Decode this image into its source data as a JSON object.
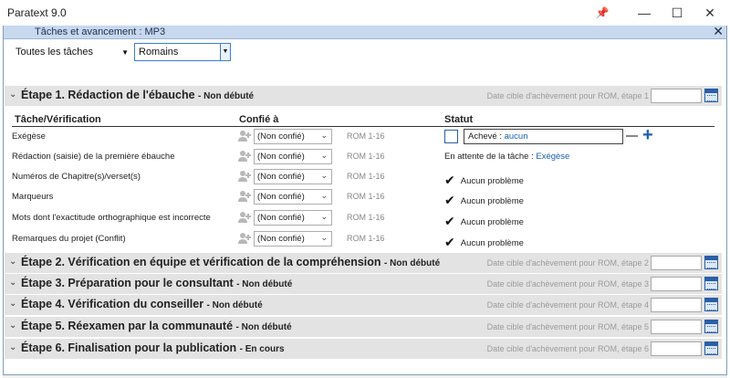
{
  "window": {
    "title": "Paratext 9.0",
    "pin": "📌",
    "min": "—",
    "max": "☐",
    "close": "✕"
  },
  "panel": {
    "title": "Tâches et avancement : MP3",
    "close": "✕"
  },
  "toolbar": {
    "tasks_filter": "Toutes les tâches",
    "book": "Romains"
  },
  "stage1": {
    "name": "Étape 1. Rédaction de l'ébauche",
    "status": "- Non débuté",
    "target": "Date cible d'achèvement pour ROM, étape 1",
    "headers": {
      "task": "Tâche/Vérification",
      "assigned": "Confié à",
      "status": "Statut"
    },
    "rows": [
      {
        "task": "Exégèse",
        "assigned": "(Non confié)",
        "ref": "ROM 1-16",
        "status_label": "Achevé : ",
        "status_link": "aucun"
      },
      {
        "task": "Rédaction (saisie) de la première ébauche",
        "assigned": "(Non confié)",
        "ref": "ROM 1-16",
        "status_label": "En attente de la tâche : ",
        "status_link": "Exégèse"
      },
      {
        "task": "Numéros de Chapitre(s)/verset(s)",
        "assigned": "(Non confié)",
        "ref": "ROM 1-16",
        "status_label": "Aucun problème"
      },
      {
        "task": "Marqueurs",
        "assigned": "(Non confié)",
        "ref": "ROM 1-16",
        "status_label": "Aucun problème"
      },
      {
        "task": "Mots dont l'exactitude orthographique est incorrecte",
        "assigned": "(Non confié)",
        "ref": "ROM 1-16",
        "status_label": "Aucun problème"
      },
      {
        "task": "Remarques du projet (Conflit)",
        "assigned": "(Non confié)",
        "ref": "ROM 1-16",
        "status_label": "Aucun problème"
      }
    ]
  },
  "stages": [
    {
      "name": "Étape 2. Vérification en équipe et vérification de la compréhension",
      "status": "- Non débuté",
      "target": "Date cible d'achèvement pour ROM, étape 2"
    },
    {
      "name": "Étape 3. Préparation pour le consultant",
      "status": "- Non débuté",
      "target": "Date cible d'achèvement pour ROM, étape 3"
    },
    {
      "name": "Étape 4. Vérification du conseiller",
      "status": "- Non débuté",
      "target": "Date cible d'achèvement pour ROM, étape 4"
    },
    {
      "name": "Étape 5. Réexamen par la communauté",
      "status": "- Non débuté",
      "target": "Date cible d'achèvement pour ROM, étape 5"
    },
    {
      "name": "Étape 6. Finalisation pour la publication",
      "status": "- En cours",
      "target": "Date cible d'achèvement pour ROM, étape 6"
    }
  ],
  "icons": {
    "check": "✔",
    "chevron_open": "⌄",
    "chevron_closed": "⌄",
    "dropdown": "▾"
  },
  "colors": {
    "accent": "#1a5fb4",
    "panel_header": "#c7d8ef",
    "stage_bg": "#e3e3e3"
  }
}
